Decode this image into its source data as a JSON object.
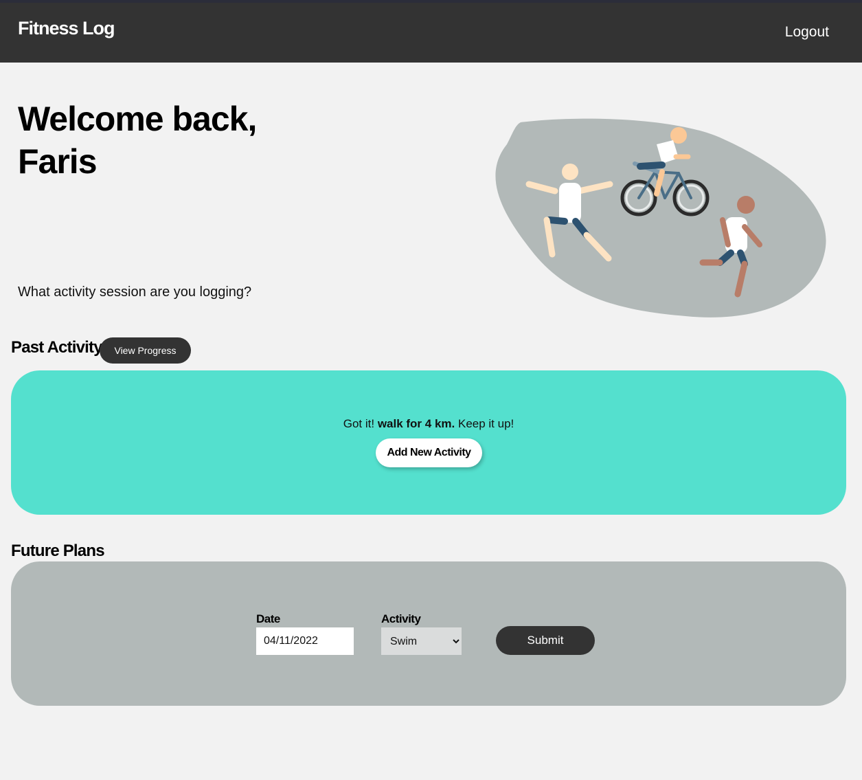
{
  "header": {
    "brand": "Fitness Log",
    "logout_label": "Logout"
  },
  "hero": {
    "welcome_line1": "Welcome back,",
    "welcome_line2": "Faris",
    "prompt": "What activity session are you logging?",
    "illustration": "people-exercising-illustration"
  },
  "past_activity": {
    "title": "Past Activity",
    "view_progress_label": "View Progress",
    "confirm_prefix": "Got it!",
    "confirm_activity": "walk for 4 km.",
    "confirm_suffix": "Keep it up!",
    "add_label": "Add New Activity"
  },
  "future_plans": {
    "title": "Future Plans",
    "date_label": "Date",
    "date_value": "04/11/2022",
    "activity_label": "Activity",
    "activity_selected": "Swim",
    "submit_label": "Submit"
  },
  "colors": {
    "header_bg": "#333333",
    "page_bg": "#f2f2f2",
    "past_panel": "#54e0ce",
    "future_panel": "#b2b9b8"
  }
}
